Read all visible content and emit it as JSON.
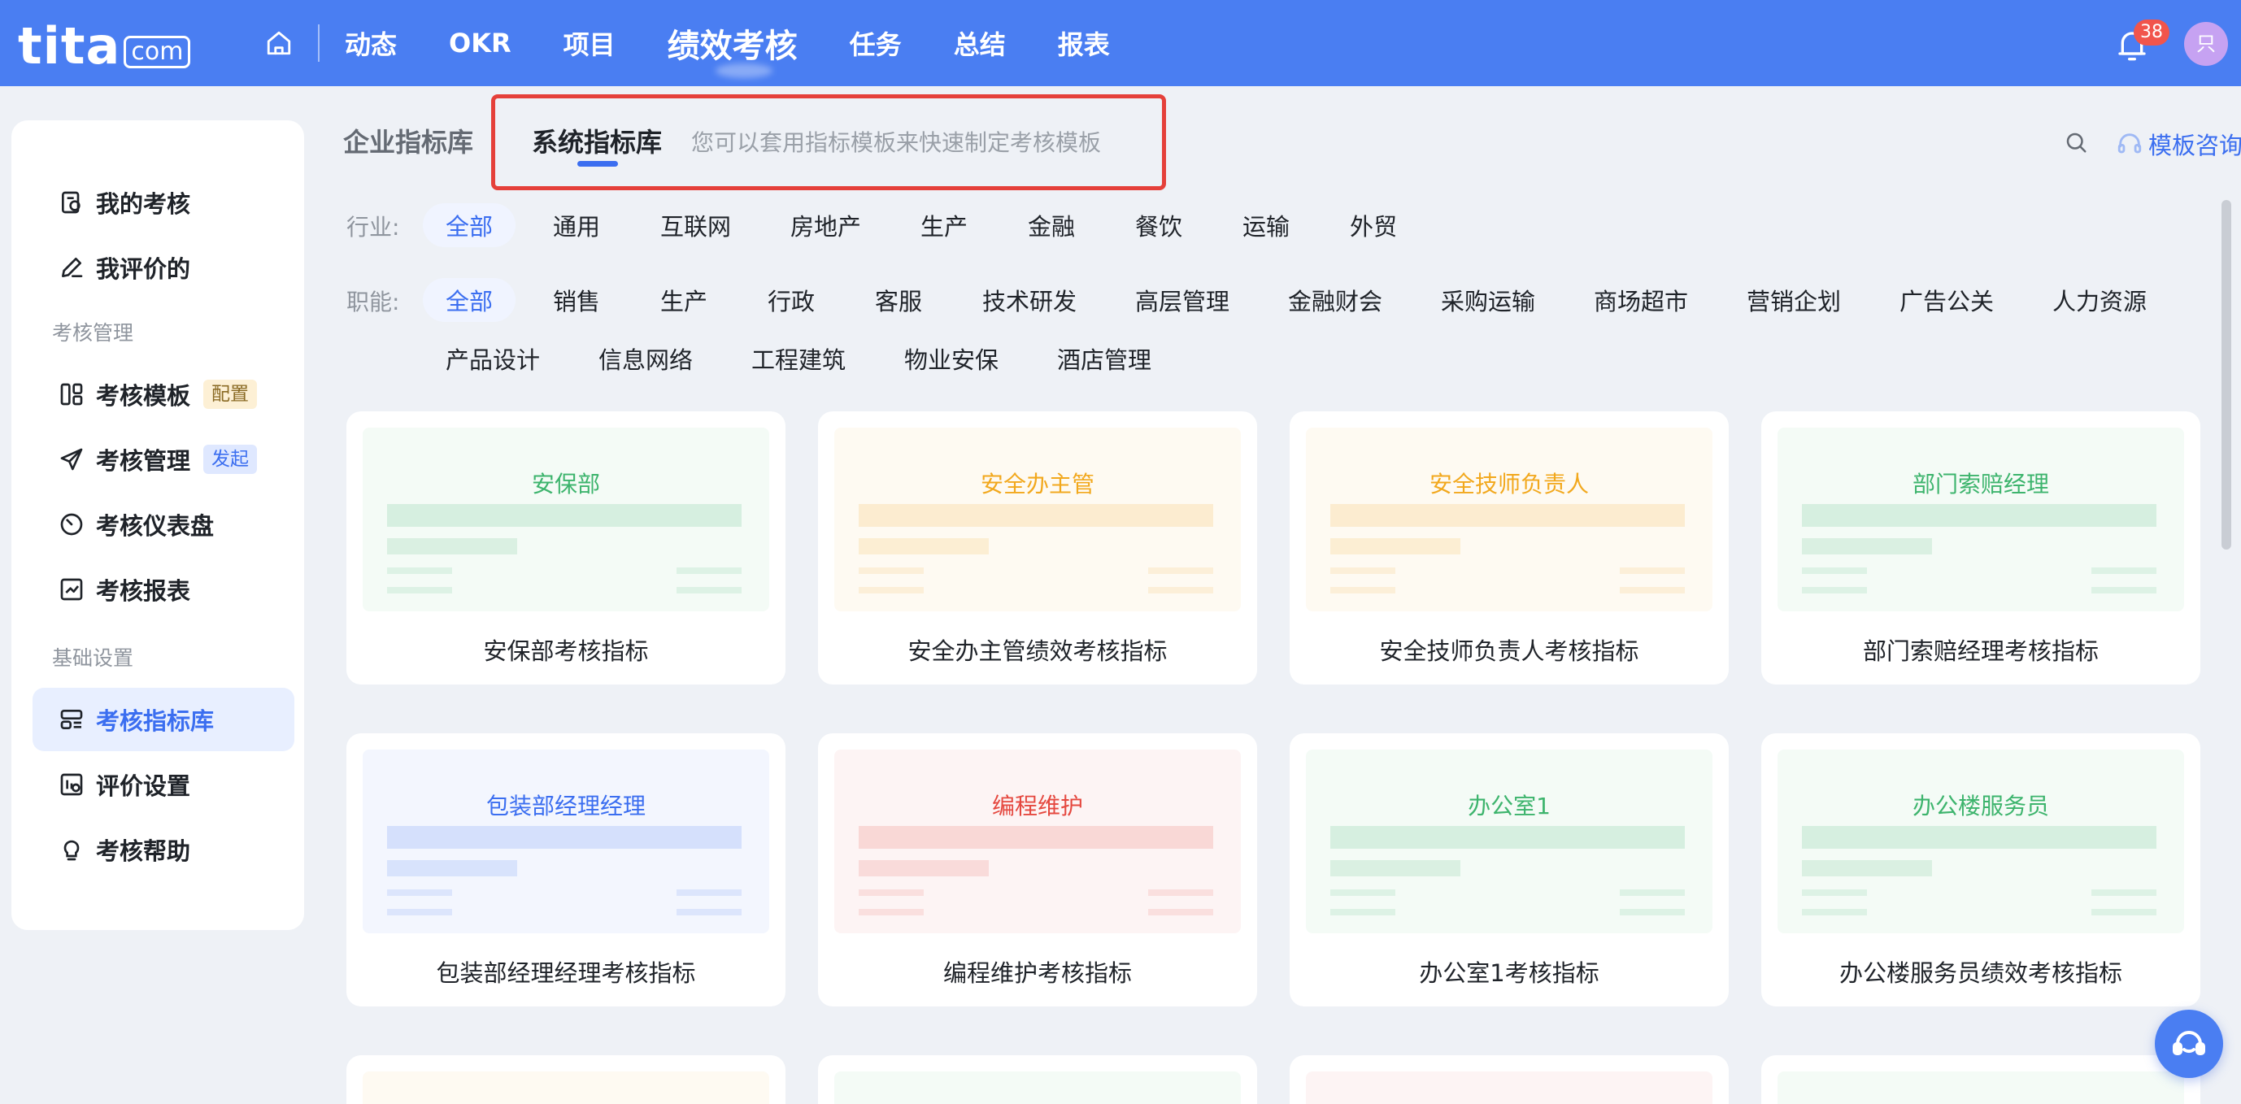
{
  "app": {
    "logo_main": "tita",
    "logo_com": "com"
  },
  "nav": {
    "items": [
      {
        "label": "动态"
      },
      {
        "label": "OKR"
      },
      {
        "label": "项目"
      },
      {
        "label": "绩效考核",
        "active": true
      },
      {
        "label": "任务"
      },
      {
        "label": "总结"
      },
      {
        "label": "报表"
      }
    ],
    "notification_count": "38",
    "avatar_initial": "只"
  },
  "sidebar": {
    "items": [
      {
        "label": "我的考核",
        "icon": "my-review-icon"
      },
      {
        "label": "我评价的",
        "icon": "edit-pen-icon"
      },
      {
        "label": "考核模板",
        "icon": "template-icon",
        "tag": "配置"
      },
      {
        "label": "考核管理",
        "icon": "send-icon",
        "tag": "发起"
      },
      {
        "label": "考核仪表盘",
        "icon": "dashboard-icon"
      },
      {
        "label": "考核报表",
        "icon": "report-icon"
      },
      {
        "label": "考核指标库",
        "icon": "indicator-library-icon",
        "active": true
      },
      {
        "label": "评价设置",
        "icon": "settings-icon"
      },
      {
        "label": "考核帮助",
        "icon": "lightbulb-icon"
      }
    ],
    "section_manage": "考核管理",
    "section_basic": "基础设置"
  },
  "main": {
    "tab_enterprise": "企业指标库",
    "tab_system": "系统指标库",
    "tab_hint": "您可以套用指标模板来快速制定考核模板",
    "consult_label": "模板咨询",
    "industry_label": "行业:",
    "industries": [
      "全部",
      "通用",
      "互联网",
      "房地产",
      "生产",
      "金融",
      "餐饮",
      "运输",
      "外贸"
    ],
    "function_label": "职能:",
    "functions": [
      "全部",
      "销售",
      "生产",
      "行政",
      "客服",
      "技术研发",
      "高层管理",
      "金融财会",
      "采购运输",
      "商场超市",
      "营销企划",
      "广告公关",
      "人力资源",
      "产品设计",
      "信息网络",
      "工程建筑",
      "物业安保",
      "酒店管理"
    ],
    "cards": [
      {
        "preview": "安保部",
        "name": "安保部考核指标",
        "theme": "#3db46d"
      },
      {
        "preview": "安全办主管",
        "name": "安全办主管绩效考核指标",
        "theme": "#f2a81d"
      },
      {
        "preview": "安全技师负责人",
        "name": "安全技师负责人考核指标",
        "theme": "#f2a81d"
      },
      {
        "preview": "部门索赔经理",
        "name": "部门索赔经理考核指标",
        "theme": "#3db46d"
      },
      {
        "preview": "包装部经理经理",
        "name": "包装部经理经理考核指标",
        "theme": "#3b6ef0"
      },
      {
        "preview": "编程维护",
        "name": "编程维护考核指标",
        "theme": "#e5483f"
      },
      {
        "preview": "办公室1",
        "name": "办公室1考核指标",
        "theme": "#3db46d"
      },
      {
        "preview": "办公楼服务员",
        "name": "办公楼服务员绩效考核指标",
        "theme": "#3db46d"
      }
    ],
    "partial_cards": [
      {
        "theme": "#f2a81d"
      },
      {
        "theme": "#3db46d"
      },
      {
        "theme": "#e5483f"
      },
      {
        "theme": "#3db46d"
      }
    ]
  },
  "colors": {
    "brand": "#4a7ef2",
    "accent": "#3b6ef0",
    "highlight_box": "#e5403a"
  }
}
